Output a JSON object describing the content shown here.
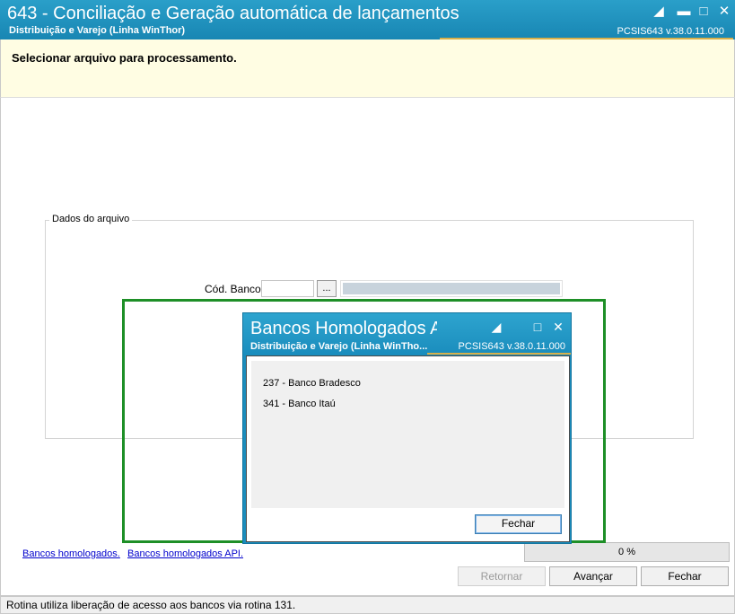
{
  "window": {
    "title": "643 - Conciliação e Geração automática de lançamentos",
    "subtitle": "Distribuição e Varejo (Linha WinThor)",
    "version": "PCSIS643  v.38.0.11.000"
  },
  "header": {
    "heading": "Selecionar arquivo para processamento."
  },
  "group": {
    "legend": "Dados do arquivo",
    "cod_banco_label": "Cód. Banco:",
    "cod_banco_value": "",
    "browse_label": "..."
  },
  "links": {
    "bancos_homologados": "Bancos homologados.",
    "bancos_homologados_api": "Bancos homologados API."
  },
  "progress": {
    "text": "0 %",
    "value": 0
  },
  "buttons": {
    "retornar": "Retornar",
    "avancar": "Avançar",
    "fechar": "Fechar"
  },
  "status_bar": {
    "text": "Rotina utiliza liberação de acesso aos bancos via rotina 131."
  },
  "dialog": {
    "title": "Bancos Homologados API",
    "subtitle": "Distribuição e Varejo (Linha WinTho...",
    "version": "PCSIS643  v.38.0.11.000",
    "banks": [
      "237 - Banco Bradesco",
      "341 - Banco Itaú"
    ],
    "close_button": "Fechar"
  },
  "colors": {
    "titlebar": "#1886b3",
    "header_band": "#fffde3",
    "highlight": "#1e8f27",
    "accent_gold": "#d9b04a",
    "link": "#0000cc"
  }
}
